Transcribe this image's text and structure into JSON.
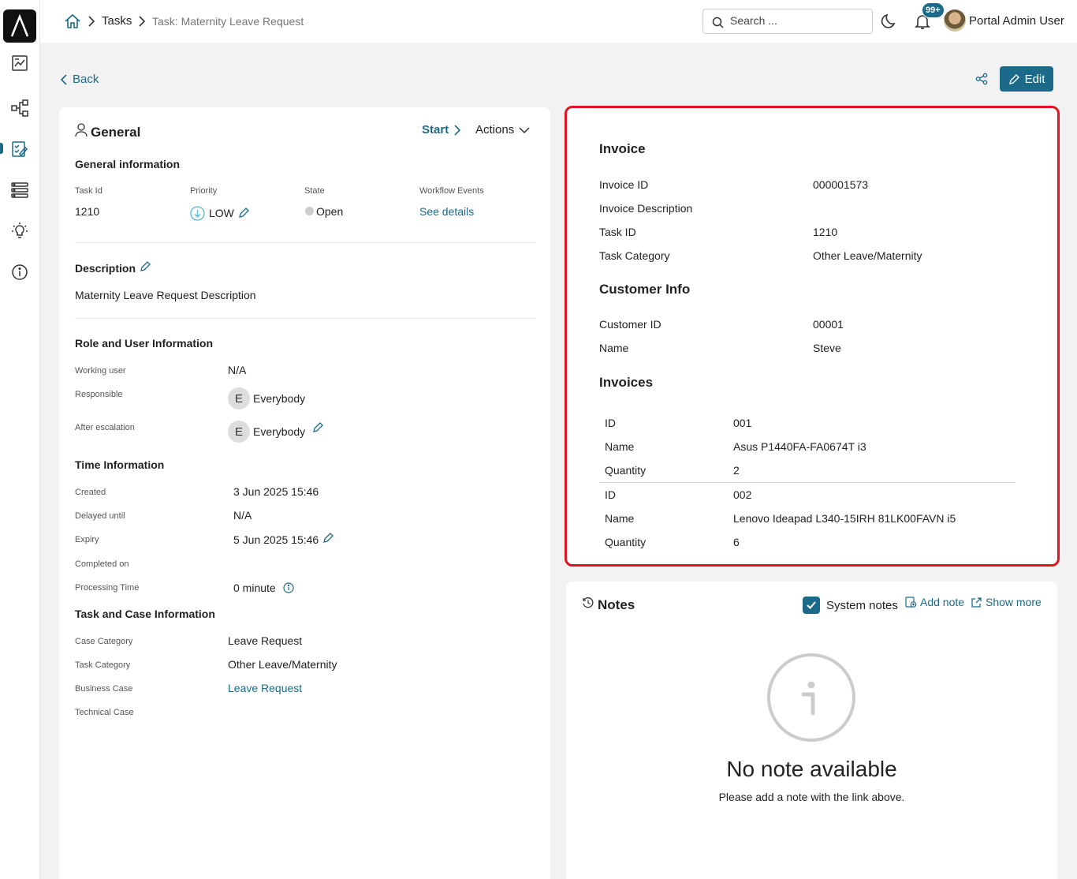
{
  "topbar": {
    "breadcrumb_tasks": "Tasks",
    "breadcrumb_current": "Task: Maternity Leave Request",
    "search_placeholder": "Search ...",
    "notification_count": "99+",
    "user_name": "Portal Admin User"
  },
  "toolbar": {
    "back_label": "Back",
    "edit_label": "Edit"
  },
  "general": {
    "title": "General",
    "start_label": "Start",
    "actions_label": "Actions",
    "info_heading": "General information",
    "task_id_label": "Task Id",
    "task_id": "1210",
    "priority_label": "Priority",
    "priority": "LOW",
    "state_label": "State",
    "state": "Open",
    "workflow_label": "Workflow Events",
    "workflow_link": "See details",
    "description_heading": "Description",
    "description": "Maternity Leave Request Description",
    "role_heading": "Role and User Information",
    "working_user_label": "Working user",
    "working_user": "N/A",
    "responsible_label": "Responsible",
    "responsible_initial": "E",
    "responsible": "Everybody",
    "after_escalation_label": "After escalation",
    "after_escalation_initial": "E",
    "after_escalation": "Everybody",
    "time_heading": "Time Information",
    "created_label": "Created",
    "created": "3 Jun 2025 15:46",
    "delayed_label": "Delayed until",
    "delayed": "N/A",
    "expiry_label": "Expiry",
    "expiry": "5 Jun 2025 15:46",
    "completed_label": "Completed on",
    "processing_label": "Processing Time",
    "processing": "0 minute",
    "case_heading": "Task and Case Information",
    "case_category_label": "Case Category",
    "case_category": "Leave Request",
    "task_category_label": "Task Category",
    "task_category": "Other Leave/Maternity",
    "business_case_label": "Business Case",
    "business_case": "Leave Request",
    "technical_case_label": "Technical Case"
  },
  "invoice": {
    "heading": "Invoice",
    "invoice_id_label": "Invoice ID",
    "invoice_id": "000001573",
    "description_label": "Invoice Description",
    "task_id_label": "Task ID",
    "task_id": "1210",
    "task_category_label": "Task Category",
    "task_category": "Other Leave/Maternity",
    "customer_heading": "Customer Info",
    "customer_id_label": "Customer ID",
    "customer_id": "00001",
    "name_label": "Name",
    "name": "Steve",
    "invoices_heading": "Invoices",
    "items": [
      {
        "id_label": "ID",
        "id": "001",
        "name_label": "Name",
        "name": "Asus P1440FA-FA0674T i3",
        "qty_label": "Quantity",
        "qty": "2"
      },
      {
        "id_label": "ID",
        "id": "002",
        "name_label": "Name",
        "name": "Lenovo Ideapad L340-15IRH 81LK00FAVN i5",
        "qty_label": "Quantity",
        "qty": "6"
      }
    ]
  },
  "notes": {
    "title": "Notes",
    "system_notes_label": "System notes",
    "add_note_label": "Add note",
    "show_more_label": "Show more",
    "empty_title": "No note available",
    "empty_hint": "Please add a note with the link above."
  },
  "colors": {
    "accent": "#1b6a8a",
    "highlight_border": "#e0141e",
    "background": "#f2f2f2"
  },
  "icons": [
    "logo-icon",
    "dashboard-icon",
    "process-icon",
    "task-icon",
    "case-list-icon",
    "idea-icon",
    "info-icon",
    "home-icon",
    "search-icon",
    "moon-icon",
    "bell-icon",
    "share-icon",
    "pencil-icon",
    "user-icon",
    "history-icon"
  ]
}
